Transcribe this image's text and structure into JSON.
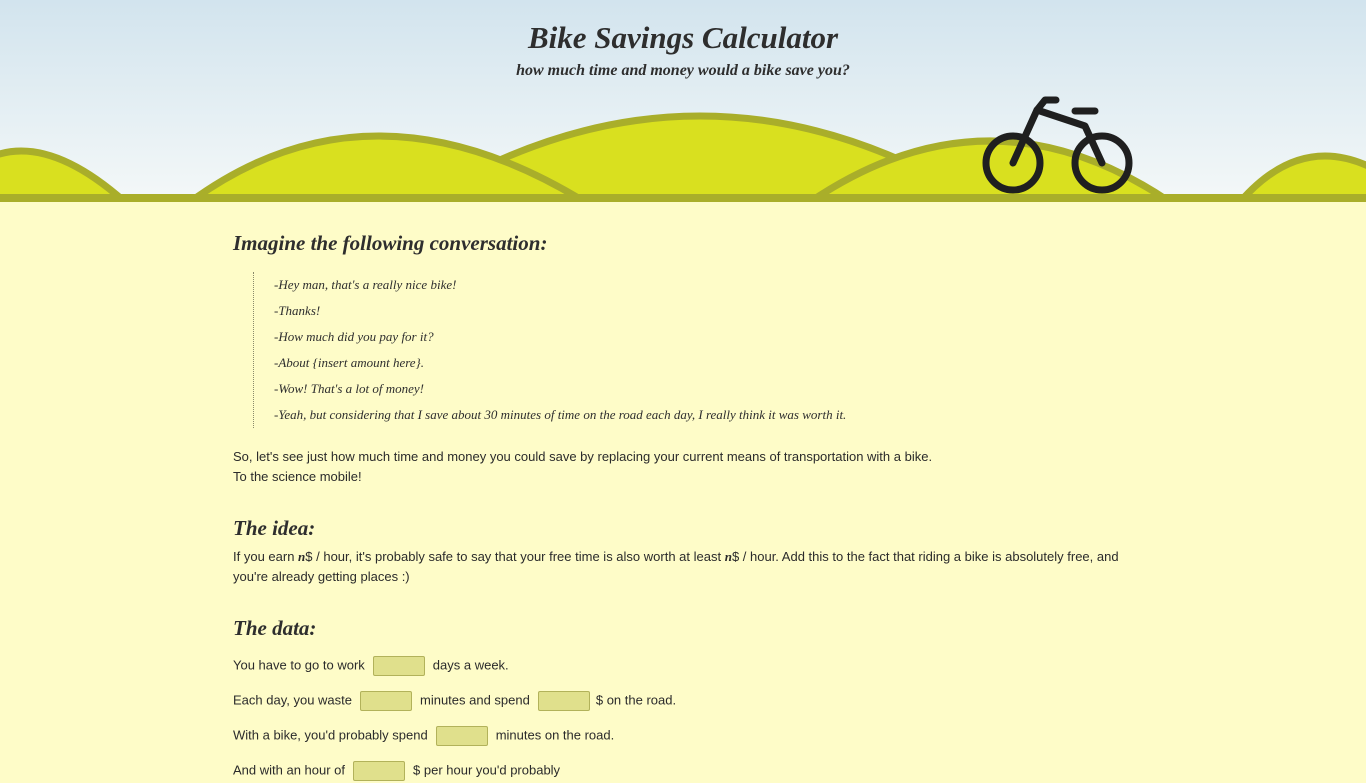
{
  "header": {
    "title": "Bike Savings Calculator",
    "subtitle": "how much time and money would a bike save you?",
    "colors": {
      "sky": "#d2e4ee",
      "hill": "#d9e01f",
      "hill_outline": "#a9ae2a",
      "bike": "#1f1f1f"
    }
  },
  "section_conversation": {
    "heading": "Imagine the following conversation:",
    "lines": [
      "-Hey man, that's a really nice bike!",
      "-Thanks!",
      "-How much did you pay for it?",
      "-About {insert amount here}.",
      "-Wow! That's a lot of money!",
      "-Yeah, but considering that I save about 30 minutes of time on the road each day, I really think it was worth it."
    ]
  },
  "intro": {
    "line1": "So, let's see just how much time and money you could save by replacing your current means of transportation with a bike.",
    "line2": "To the science mobile!"
  },
  "section_idea": {
    "heading": "The idea:",
    "part1": "If you earn ",
    "var1": "n",
    "part2": "$ / hour, it's probably safe to say that your free time is also worth at least ",
    "var2": "n",
    "part3": "$ / hour. Add this to the fact that riding a bike is absolutely free, and you're already getting places :)"
  },
  "section_data": {
    "heading": "The data:",
    "row1": {
      "before": "You have to go to work",
      "after": "days a week.",
      "value": ""
    },
    "row2": {
      "before": "Each day, you waste",
      "middle": "minutes and spend",
      "after": "$ on the road.",
      "value1": "",
      "value2": ""
    },
    "row3": {
      "before": "With a bike, you'd probably spend",
      "after": "minutes on the road.",
      "value": ""
    },
    "row4": {
      "before": "And with an hour of",
      "after": "$ per hour you'd probably",
      "value": ""
    }
  }
}
